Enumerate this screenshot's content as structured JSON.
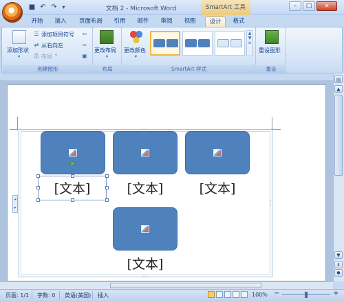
{
  "window": {
    "title": "文档 2 - Microsoft Word",
    "context_title": "SmartArt 工具",
    "buttons": {
      "minimize": "–",
      "maximize": "□",
      "close": "×"
    }
  },
  "qat": {
    "save": "■",
    "undo": "↶",
    "redo": "↷"
  },
  "tabs": [
    "开始",
    "插入",
    "页面布局",
    "引用",
    "邮件",
    "审阅",
    "视图",
    "设计",
    "格式"
  ],
  "active_tab": "设计",
  "ribbon": {
    "create_graphic": {
      "add_shape": "添加形状",
      "add_bullet": "添加项目符号",
      "right_to_left": "从右向左",
      "layout": "布局",
      "label": "创建图形"
    },
    "layouts": {
      "change_layout": "更改布局",
      "label": "布局"
    },
    "styles": {
      "change_colors": "更改颜色",
      "label": "SmartArt 样式"
    },
    "reset": {
      "reset_graphic": "重设图形",
      "label": "重设"
    }
  },
  "smartart": {
    "placeholder_text": "[文本]"
  },
  "status": {
    "page": "页面: 1/1",
    "words": "字数: 0",
    "language": "英语(美国)",
    "mode": "插入",
    "zoom": "100%",
    "zoom_minus": "−",
    "zoom_plus": "+"
  },
  "colors": {
    "shape_fill": "#4f81bd",
    "ribbon_bg": "#dbe7f7",
    "context_tab": "#eacb7e"
  }
}
